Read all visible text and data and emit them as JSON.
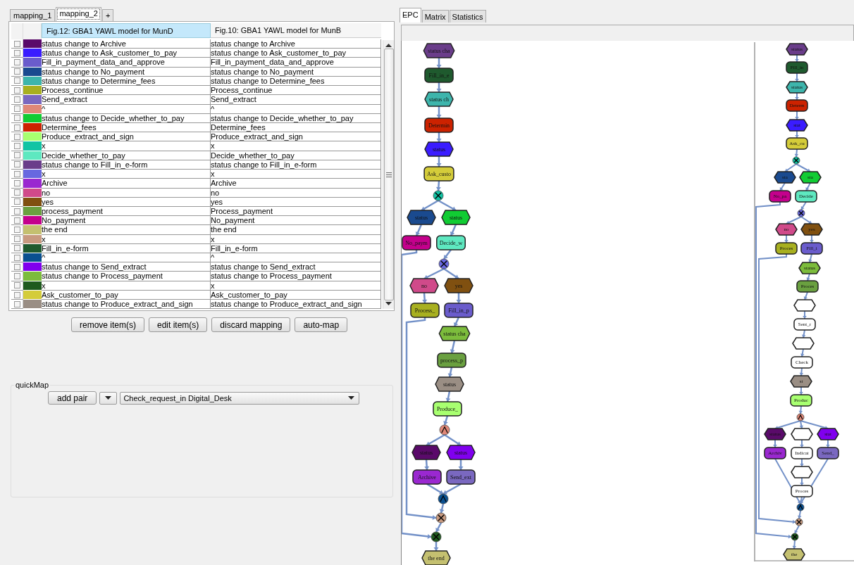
{
  "mapping_tabs": [
    {
      "label": "mapping_1",
      "selected": false
    },
    {
      "label": "mapping_2",
      "selected": true
    },
    {
      "label": "+",
      "selected": false
    }
  ],
  "table": {
    "columns": [
      "Fig.12: GBA1 YAWL model for MunD",
      "Fig.10: GBA1 YAWL model for MunB"
    ],
    "rows": [
      {
        "checked": false,
        "color": "#5a0a6a",
        "left": "status change to Archive",
        "right": "status change to Archive"
      },
      {
        "checked": false,
        "color": "#3a1cff",
        "left": "status change to Ask_customer_to_pay",
        "right": "status change to Ask_customer_to_pay"
      },
      {
        "checked": false,
        "color": "#6a5ccc",
        "left": "Fill_in_payment_data_and_approve",
        "right": "Fill_in_payment_data_and_approve"
      },
      {
        "checked": false,
        "color": "#1a4a8f",
        "left": "status change to No_payment",
        "right": "status change to No_payment"
      },
      {
        "checked": false,
        "color": "#3db5ac",
        "left": "status change to Determine_fees",
        "right": "status change to Determine_fees"
      },
      {
        "checked": false,
        "color": "#a8b020",
        "left": "Process_continue",
        "right": "Process_continue"
      },
      {
        "checked": false,
        "color": "#7a68c0",
        "left": "Send_extract",
        "right": "Send_extract"
      },
      {
        "checked": false,
        "color": "#e08878",
        "left": "^",
        "right": "^"
      },
      {
        "checked": false,
        "color": "#11cc33",
        "left": "status change to Decide_whether_to_pay",
        "right": "status change to Decide_whether_to_pay"
      },
      {
        "checked": false,
        "color": "#cc2200",
        "left": "Determine_fees",
        "right": "Determine_fees"
      },
      {
        "checked": false,
        "color": "#a8ff70",
        "left": "Produce_extract_and_sign",
        "right": "Produce_extract_and_sign"
      },
      {
        "checked": false,
        "color": "#11c4a4",
        "left": "x",
        "right": "x"
      },
      {
        "checked": false,
        "color": "#5ee8c0",
        "left": "Decide_whether_to_pay",
        "right": "Decide_whether_to_pay"
      },
      {
        "checked": false,
        "color": "#6a3d8a",
        "left": "status change to Fill_in_e-form",
        "right": "status change to Fill_in_e-form"
      },
      {
        "checked": false,
        "color": "#6868e0",
        "left": "x",
        "right": "x"
      },
      {
        "checked": false,
        "color": "#9a28d0",
        "left": "Archive",
        "right": "Archive"
      },
      {
        "checked": false,
        "color": "#d04a8a",
        "left": "no",
        "right": "no"
      },
      {
        "checked": false,
        "color": "#805010",
        "left": "yes",
        "right": "yes"
      },
      {
        "checked": false,
        "color": "#6aa040",
        "left": "process_payment",
        "right": "Process_payment"
      },
      {
        "checked": false,
        "color": "#c4008c",
        "left": "No_payment",
        "right": "No_payment"
      },
      {
        "checked": false,
        "color": "#c4c070",
        "left": "the end",
        "right": "the end"
      },
      {
        "checked": false,
        "color": "#c89a80",
        "left": "x",
        "right": "x"
      },
      {
        "checked": false,
        "color": "#1f5a2e",
        "left": "Fill_in_e-form",
        "right": "Fill_in_e-form"
      },
      {
        "checked": false,
        "color": "#0a5090",
        "left": "^",
        "right": "^"
      },
      {
        "checked": false,
        "color": "#8000ee",
        "left": "status change to Send_extract",
        "right": "status change to Send_extract"
      },
      {
        "checked": false,
        "color": "#7cbc3c",
        "left": "status change to Process_payment",
        "right": "status change to Process_payment"
      },
      {
        "checked": false,
        "color": "#1e5a1e",
        "left": "x",
        "right": "x"
      },
      {
        "checked": false,
        "color": "#d4cc3a",
        "left": "Ask_customer_to_pay",
        "right": "Ask_customer_to_pay"
      },
      {
        "checked": false,
        "color": "#9a8e84",
        "left": "status change to Produce_extract_and_sign",
        "right": "status change to Produce_extract_and_sign"
      }
    ]
  },
  "buttons": [
    "remove item(s)",
    "edit item(s)",
    "discard mapping",
    "auto-map"
  ],
  "quick_map": {
    "title": "quickMap",
    "add_button": "add pair",
    "selection": "Check_request_in Digital_Desk"
  },
  "view_tabs": [
    {
      "label": "EPC",
      "selected": true
    },
    {
      "label": "Matrix",
      "selected": false
    },
    {
      "label": "Statistics",
      "selected": false
    }
  ],
  "diagrams": [
    {
      "nodes": [
        {
          "kind": "event",
          "label": "status cha",
          "color": "#6a3d8a"
        },
        {
          "kind": "function",
          "label": "Fill_in_e",
          "color": "#1f5a2e"
        },
        {
          "kind": "event",
          "label": "status ch",
          "color": "#3db5ac"
        },
        {
          "kind": "function",
          "label": "Determin",
          "color": "#cc2200"
        },
        {
          "kind": "event",
          "label": "status",
          "color": "#3a1cff"
        },
        {
          "kind": "function",
          "label": "Ask_custo",
          "color": "#d4cc3a"
        },
        {
          "kind": "xor",
          "color": "#11c4a4"
        },
        {
          "kind": "event",
          "label": "status",
          "color": "#1a4a8f"
        },
        {
          "kind": "event",
          "label": "status",
          "color": "#11cc33"
        },
        {
          "kind": "function",
          "label": "No_paym",
          "color": "#c4008c"
        },
        {
          "kind": "function",
          "label": "Decide_w",
          "color": "#5ee8c0"
        },
        {
          "kind": "xor",
          "color": "#6868e0"
        },
        {
          "kind": "event",
          "label": "no",
          "color": "#d04a8a"
        },
        {
          "kind": "event",
          "label": "yes",
          "color": "#805010"
        },
        {
          "kind": "function",
          "label": "Process_",
          "color": "#a8b020"
        },
        {
          "kind": "function",
          "label": "Fill_in_p",
          "color": "#6a5ccc"
        },
        {
          "kind": "event",
          "label": "status cha",
          "color": "#7cbc3c"
        },
        {
          "kind": "function",
          "label": "process_p",
          "color": "#6aa040"
        },
        {
          "kind": "event",
          "label": "status",
          "color": "#9a8e84"
        },
        {
          "kind": "function",
          "label": "Produce_",
          "color": "#a8ff70"
        },
        {
          "kind": "and",
          "color": "#e08878"
        },
        {
          "kind": "event",
          "label": "status",
          "color": "#5a0a6a"
        },
        {
          "kind": "event",
          "label": "status",
          "color": "#8000ee"
        },
        {
          "kind": "function",
          "label": "Archive",
          "color": "#9a28d0"
        },
        {
          "kind": "function",
          "label": "Send_ext",
          "color": "#7a68c0"
        },
        {
          "kind": "and",
          "color": "#0a5090"
        },
        {
          "kind": "xor",
          "color": "#c89a80"
        },
        {
          "kind": "xor",
          "color": "#1e5a1e"
        },
        {
          "kind": "event",
          "label": "the end",
          "color": "#c4c070"
        }
      ]
    },
    {
      "nodes": [
        {
          "kind": "event",
          "label": "status",
          "color": "#6a3d8a"
        },
        {
          "kind": "function",
          "label": "Fill_in",
          "color": "#1f5a2e"
        },
        {
          "kind": "event",
          "label": "status",
          "color": "#3db5ac"
        },
        {
          "kind": "function",
          "label": "Determ",
          "color": "#cc2200"
        },
        {
          "kind": "event",
          "label": "stat",
          "color": "#3a1cff"
        },
        {
          "kind": "function",
          "label": "Ask_cu",
          "color": "#d4cc3a"
        },
        {
          "kind": "xor",
          "color": "#11c4a4"
        },
        {
          "kind": "event",
          "label": "sta",
          "color": "#1a4a8f"
        },
        {
          "kind": "event",
          "label": "sta",
          "color": "#11cc33"
        },
        {
          "kind": "function",
          "label": "No_pa",
          "color": "#c4008c"
        },
        {
          "kind": "function",
          "label": "Decide",
          "color": "#5ee8c0"
        },
        {
          "kind": "xor",
          "color": "#6868e0"
        },
        {
          "kind": "event",
          "label": "no",
          "color": "#d04a8a"
        },
        {
          "kind": "event",
          "label": "yes",
          "color": "#805010"
        },
        {
          "kind": "function",
          "label": "Proces",
          "color": "#a8b020"
        },
        {
          "kind": "function",
          "label": "Fill_i",
          "color": "#6a5ccc"
        },
        {
          "kind": "event",
          "label": "status",
          "color": "#7cbc3c"
        },
        {
          "kind": "function",
          "label": "Proces",
          "color": "#6aa040"
        },
        {
          "kind": "event",
          "color": "#ffffff"
        },
        {
          "kind": "function",
          "label": "Sent_r",
          "color": "#ffffff"
        },
        {
          "kind": "event",
          "color": "#ffffff"
        },
        {
          "kind": "function",
          "label": "Check",
          "color": "#ffffff"
        },
        {
          "kind": "event",
          "label": "st",
          "color": "#9a8e84"
        },
        {
          "kind": "function",
          "label": "Produc",
          "color": "#a8ff70"
        },
        {
          "kind": "and",
          "color": "#e08878"
        },
        {
          "kind": "event",
          "label": "status",
          "color": "#5a0a6a"
        },
        {
          "kind": "event",
          "color": "#ffffff"
        },
        {
          "kind": "event",
          "label": "stat",
          "color": "#8000ee"
        },
        {
          "kind": "function",
          "label": "Archiv",
          "color": "#9a28d0"
        },
        {
          "kind": "function",
          "label": "Indicat",
          "color": "#ffffff"
        },
        {
          "kind": "function",
          "label": "Send_",
          "color": "#7a68c0"
        },
        {
          "kind": "event",
          "color": "#ffffff"
        },
        {
          "kind": "function",
          "label": "Proces",
          "color": "#ffffff"
        },
        {
          "kind": "and",
          "color": "#0a5090"
        },
        {
          "kind": "xor",
          "color": "#c89a80"
        },
        {
          "kind": "xor",
          "color": "#1e5a1e"
        },
        {
          "kind": "event",
          "label": "the",
          "color": "#c4c070"
        }
      ]
    }
  ]
}
